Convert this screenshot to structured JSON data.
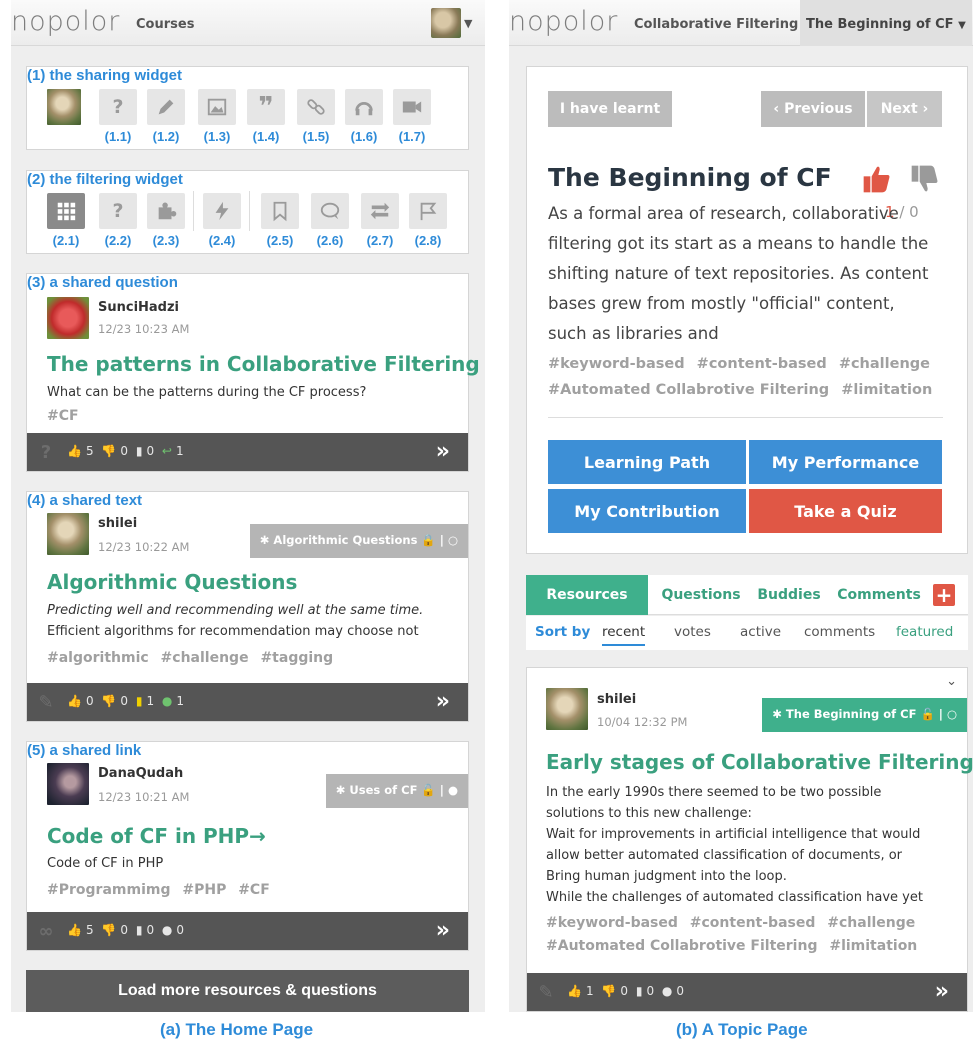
{
  "home": {
    "logo": "nopolor",
    "nav_courses": "Courses",
    "sections": {
      "sharing": "(1) the sharing widget",
      "filtering": "(2) the filtering widget",
      "question": "(3) a shared question",
      "text": "(4) a shared text",
      "link": "(5) a shared link"
    },
    "sharing_labels": [
      "(1.1)",
      "(1.2)",
      "(1.3)",
      "(1.4)",
      "(1.5)",
      "(1.6)",
      "(1.7)"
    ],
    "filtering_labels": [
      "(2.1)",
      "(2.2)",
      "(2.3)",
      "(2.4)",
      "(2.5)",
      "(2.6)",
      "(2.7)",
      "(2.8)"
    ],
    "question_card": {
      "user": "SunciHadzi",
      "time": "12/23 10:23 AM",
      "title": "The patterns in Collaborative Filtering",
      "body": "What can be the patterns during the CF process?",
      "tags": [
        "#CF"
      ],
      "likes": "5",
      "dislikes": "0",
      "bookmarks": "0",
      "replies": "1"
    },
    "text_card": {
      "user": "shilei",
      "time": "12/23 10:22 AM",
      "topic": "✱ Algorithmic Questions 🔒 | ○",
      "title": "Algorithmic Questions",
      "body_italic": "Predicting well and recommending well at the same time.",
      "body": "Efficient algorithms for recommendation may choose not",
      "tags": [
        "#algorithmic",
        "#challenge",
        "#tagging"
      ],
      "likes": "0",
      "dislikes": "0",
      "bookmarks": "1",
      "comments": "1"
    },
    "link_card": {
      "user": "DanaQudah",
      "time": "12/23 10:21 AM",
      "topic": "✱ Uses of CF 🔓 | ●",
      "title": "Code of CF in PHP→",
      "body": "Code of CF in PHP",
      "tags": [
        "#Programmimg",
        "#PHP",
        "#CF"
      ],
      "likes": "5",
      "dislikes": "0",
      "bookmarks": "0",
      "comments": "0"
    },
    "load_more": "Load more resources & questions",
    "caption": "(a) The Home Page"
  },
  "topic": {
    "logo": "nopolor",
    "nav_course": "Collaborative Filtering",
    "nav_topic": "The Beginning of CF",
    "learnt_button": "I have learnt",
    "prev_button": "‹ Previous",
    "next_button": "Next ›",
    "title": "The Beginning of CF",
    "upvotes": "1",
    "downvotes": "0",
    "body": "As a formal area of research, collaborative filtering got its start as a means to handle the shifting nature of text repositories. As content bases grew from mostly \"official\" content, such as libraries and",
    "tags": [
      "#keyword-based",
      "#content-based",
      "#challenge",
      "#Automated Collabrotive Filtering",
      "#limitation"
    ],
    "buttons": {
      "learning_path": "Learning Path",
      "performance": "My Performance",
      "contribution": "My Contribution",
      "quiz": "Take a Quiz"
    },
    "tabs": [
      "Resources",
      "Questions",
      "Buddies",
      "Comments"
    ],
    "sort_label": "Sort by",
    "sort_options": [
      "recent",
      "votes",
      "active",
      "comments",
      "featured"
    ],
    "resource_card": {
      "user": "shilei",
      "time": "10/04 12:32 PM",
      "topic": "✱ The Beginning of CF 🔓 | ○",
      "title": "Early stages of Collaborative Filtering",
      "lines": [
        "In the early 1990s there seemed to be two possible",
        "solutions to this new challenge:",
        "Wait for improvements in artificial intelligence that would",
        "allow better automated classification of documents, or",
        "Bring human judgment into the loop.",
        "While the challenges of automated classification have yet"
      ],
      "tags": [
        "#keyword-based",
        "#content-based",
        "#challenge",
        "#Automated Collabrotive Filtering",
        "#limitation"
      ],
      "likes": "1",
      "dislikes": "0",
      "bookmarks": "0",
      "comments": "0"
    },
    "caption": "(b) A Topic Page"
  },
  "colors": {
    "accent_green": "#3fb08c",
    "annotation_blue": "#2e8bd8",
    "button_blue": "#3d8fd6",
    "button_red": "#e05745"
  }
}
